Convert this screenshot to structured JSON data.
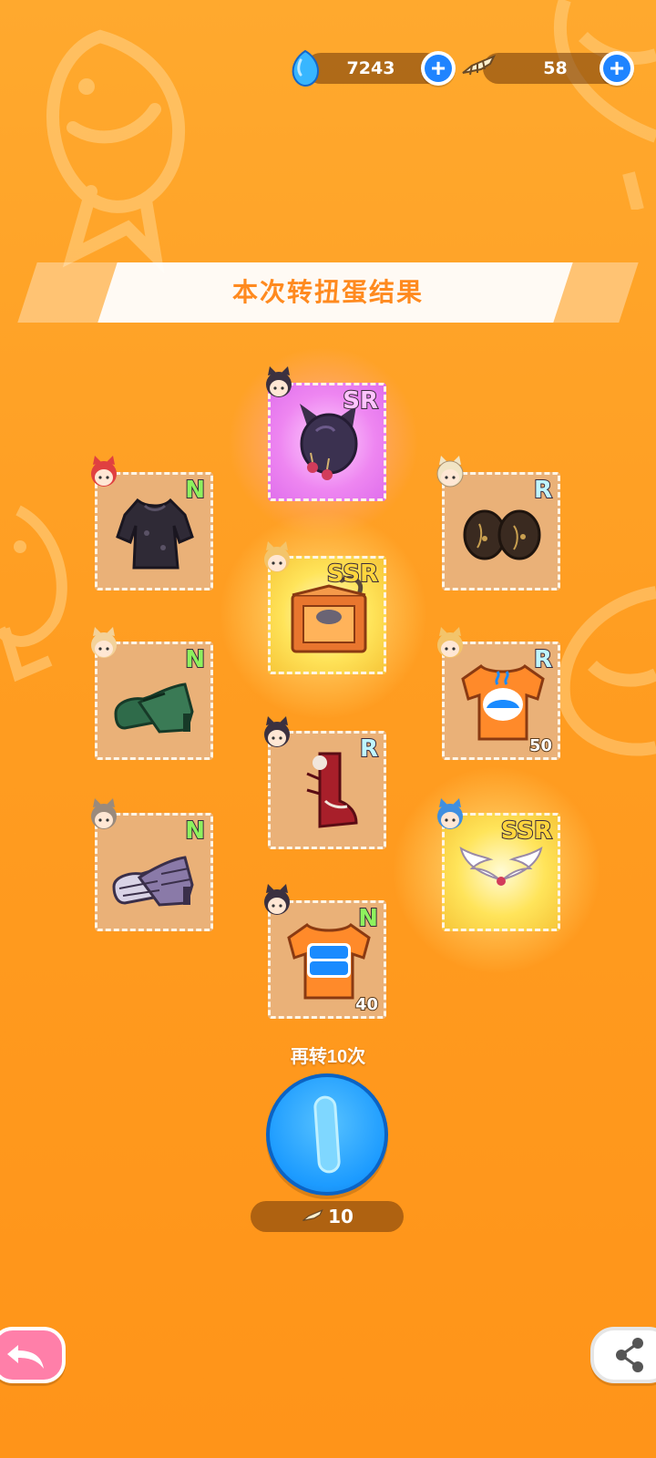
{
  "currency": {
    "gems": {
      "icon": "blue-gem-icon",
      "value": "7243"
    },
    "fish": {
      "icon": "fish-bone-icon",
      "value": "58"
    }
  },
  "banner": {
    "title": "本次转扭蛋结果"
  },
  "items": [
    {
      "id": "sr-cat-hairpin",
      "rarity": "SR",
      "count": "",
      "chara_color": "#3b3140"
    },
    {
      "id": "n-black-dress",
      "rarity": "N",
      "count": "",
      "chara_color": "#e04040"
    },
    {
      "id": "r-dark-earmuffs",
      "rarity": "R",
      "count": "",
      "chara_color": "#f1e4c4"
    },
    {
      "id": "ssr-cat-box",
      "rarity": "SSR",
      "count": "",
      "chara_color": "#f3c46b"
    },
    {
      "id": "n-green-shoes",
      "rarity": "N",
      "count": "",
      "chara_color": "#f3d29a"
    },
    {
      "id": "r-orange-shirt",
      "rarity": "R",
      "count": "50",
      "chara_color": "#f3c46b"
    },
    {
      "id": "r-red-boot",
      "rarity": "R",
      "count": "",
      "chara_color": "#3b3140"
    },
    {
      "id": "n-purple-shoes",
      "rarity": "N",
      "count": "",
      "chara_color": "#9a8a7c"
    },
    {
      "id": "ssr-angel-wings",
      "rarity": "SSR",
      "count": "",
      "chara_color": "#3f8fe0"
    },
    {
      "id": "n-blue-print-shirt",
      "rarity": "N",
      "count": "40",
      "chara_color": "#3b3140"
    }
  ],
  "again": {
    "label": "再转10次",
    "cost": "10"
  },
  "colors": {
    "accent": "#ff8a1f",
    "button_blue": "#1c9bff",
    "back_pink": "#ff7fa9"
  }
}
